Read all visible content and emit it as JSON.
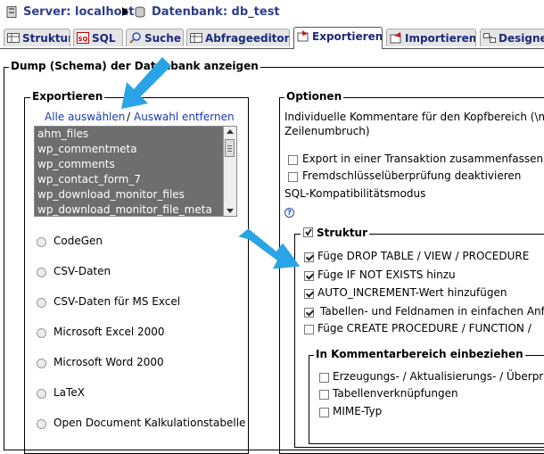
{
  "breadcrumb": {
    "server_label": "Server: localhost",
    "db_label": "Datenbank: db_test"
  },
  "tabs": [
    {
      "label": "Struktur"
    },
    {
      "label": "SQL"
    },
    {
      "label": "Suche"
    },
    {
      "label": "Abfrageeditor"
    },
    {
      "label": "Exportieren"
    },
    {
      "label": "Importieren"
    },
    {
      "label": "Designe"
    }
  ],
  "main_legend": "Dump (Schema) der Datenbank anzeigen",
  "export": {
    "legend": "Exportieren",
    "select_all": "Alle auswählen",
    "separator": "/",
    "deselect_all": "Auswahl entfernen",
    "tables": [
      "ahm_files",
      "wp_commentmeta",
      "wp_comments",
      "wp_contact_form_7",
      "wp_download_monitor_files",
      "wp_download_monitor_file_meta"
    ],
    "formats": [
      "CodeGen",
      "CSV-Daten",
      "CSV-Daten für MS Excel",
      "Microsoft Excel 2000",
      "Microsoft Word 2000",
      "LaTeX",
      "Open Document Kalkulationstabelle"
    ]
  },
  "options": {
    "legend": "Optionen",
    "comment_line1": "Individuelle Kommentare für den Kopfbereich (\\n erz",
    "comment_line2": "Zeilenumbruch)",
    "transaction": "Export in einer Transaktion zusammenfassen",
    "fk_checks": "Fremdschlüsselüberprüfung deaktivieren",
    "compat": "SQL-Kompatibilitätsmodus",
    "help_glyph": "?",
    "structure": {
      "legend": "Struktur",
      "items": [
        {
          "label": "Füge DROP TABLE / VIEW / PROCEDURE",
          "checked": true
        },
        {
          "label": "Füge IF NOT EXISTS hinzu",
          "checked": true
        },
        {
          "label": "AUTO_INCREMENT-Wert hinzufügen",
          "checked": true
        },
        {
          "label": "Tabellen- und Feldnamen in einfachen Anfü",
          "checked": true
        },
        {
          "label": "Füge CREATE PROCEDURE / FUNCTION /",
          "checked": false
        }
      ],
      "comments": {
        "legend": "In Kommentarbereich einbeziehen",
        "items": [
          {
            "label": "Erzeugungs- / Aktualisierungs- / Überprüf",
            "checked": false
          },
          {
            "label": "Tabellenverknüpfungen",
            "checked": false
          },
          {
            "label": "MIME-Typ",
            "checked": false
          }
        ]
      }
    }
  }
}
